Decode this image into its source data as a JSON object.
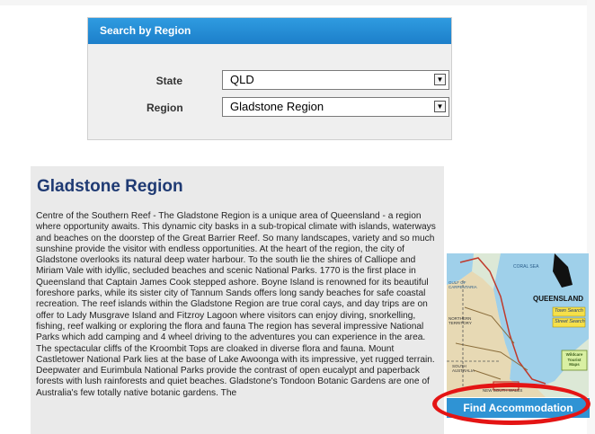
{
  "search": {
    "title": "Search by Region",
    "state_label": "State",
    "state_value": "QLD",
    "region_label": "Region",
    "region_value": "Gladstone Region"
  },
  "region": {
    "title": "Gladstone Region",
    "description": "Centre of the Southern Reef - The Gladstone Region is a unique area of Queensland - a region where opportunity awaits. This dynamic city basks in a sub-tropical climate with islands, waterways and beaches on the doorstep of the Great Barrier Reef. So many landscapes, variety and so much sunshine provide the visitor with endless opportunities. At the heart of the region, the city of Gladstone overlooks its natural deep water harbour. To the south lie the shires of Calliope and Miriam Vale with idyllic, secluded beaches and scenic National Parks. 1770 is the first place in Queensland that Captain James Cook stepped ashore. Boyne Island is renowned for its beautiful foreshore parks, while its sister city of Tannum Sands offers long sandy beaches for safe coastal recreation. The reef islands within the Gladstone Region are true coral cays, and day trips are on offer to Lady Musgrave Island and Fitzroy Lagoon where visitors can enjoy diving, snorkelling, fishing, reef walking or exploring the flora and fauna The region has several impressive National Parks which add camping and 4 wheel driving to the adventures you can experience in the area. The spectacular cliffs of the Kroombit Tops are cloaked in diverse flora and fauna. Mount Castletower National Park lies at the base of Lake Awoonga with its impressive, yet rugged terrain. Deepwater and Eurimbula National Parks provide the contrast of open eucalypt and paperback forests with lush rainforests and quiet beaches. Gladstone's Tondoon Botanic Gardens are one of Australia's few totally native botanic gardens. The"
  },
  "map": {
    "title": "QUEENSLAND",
    "town_search": "Town Search",
    "street_search": "Street Search",
    "coral_sea": "CORAL SEA",
    "gulf": "GULF OF CARPENTARIA",
    "nt": "NORTHERN TERRITORY",
    "sa": "SOUTH AUSTRALIA",
    "nsw": "NEW SOUTH WALES",
    "badge": "Wildcare Tourist Maps"
  },
  "find_button": "Find Accommodation",
  "colors": {
    "header_blue": "#1c7fca",
    "button_blue": "#2f93d4",
    "title_navy": "#1f3a73",
    "highlight_red": "#e41414"
  }
}
